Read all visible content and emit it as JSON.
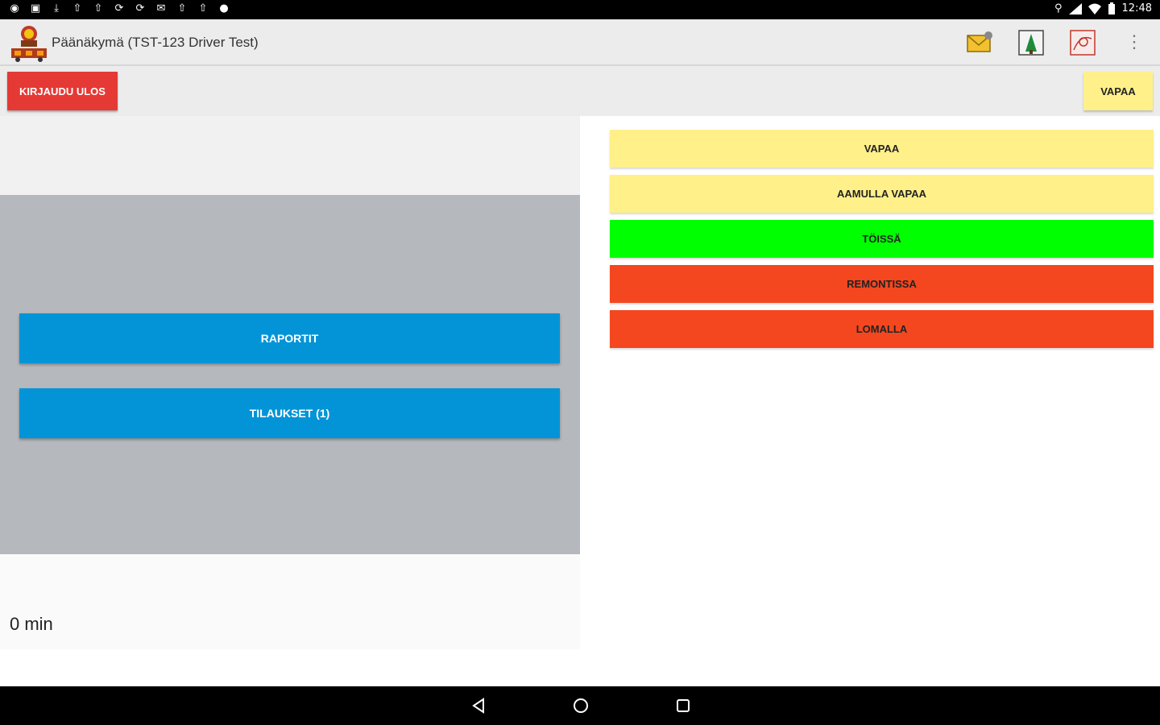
{
  "status_bar": {
    "time": "12:48",
    "left_icons": [
      "globe-icon",
      "image-icon",
      "download-icon",
      "upload-icon",
      "upload-icon",
      "sync-icon",
      "sync-icon",
      "mail-icon",
      "upload-icon",
      "upload-icon",
      "android-icon"
    ],
    "right_icons": [
      "location-icon",
      "signal-icon",
      "wifi-icon",
      "battery-icon"
    ]
  },
  "action_bar": {
    "title": "Päänäkymä (TST-123 Driver Test)",
    "icons": [
      "messages-icon",
      "tree-icon",
      "map-icon"
    ],
    "overflow": "⋮"
  },
  "toolbar": {
    "logout_label": "KIRJAUDU ULOS",
    "current_status_label": "VAPAA"
  },
  "main": {
    "reports_label": "RAPORTIT",
    "orders_label": "TILAUKSET (1)",
    "timer": "0 min"
  },
  "status_options": [
    {
      "label": "VAPAA",
      "color": "#fff08a"
    },
    {
      "label": "AAMULLA VAPAA",
      "color": "#fff08a"
    },
    {
      "label": "TÖISSÄ",
      "color": "#00ff00"
    },
    {
      "label": "REMONTISSA",
      "color": "#f4471f"
    },
    {
      "label": "LOMALLA",
      "color": "#f4471f"
    }
  ],
  "colors": {
    "logout": "#e53935",
    "primary": "#0394d8",
    "panel": "#b5b8bc"
  }
}
